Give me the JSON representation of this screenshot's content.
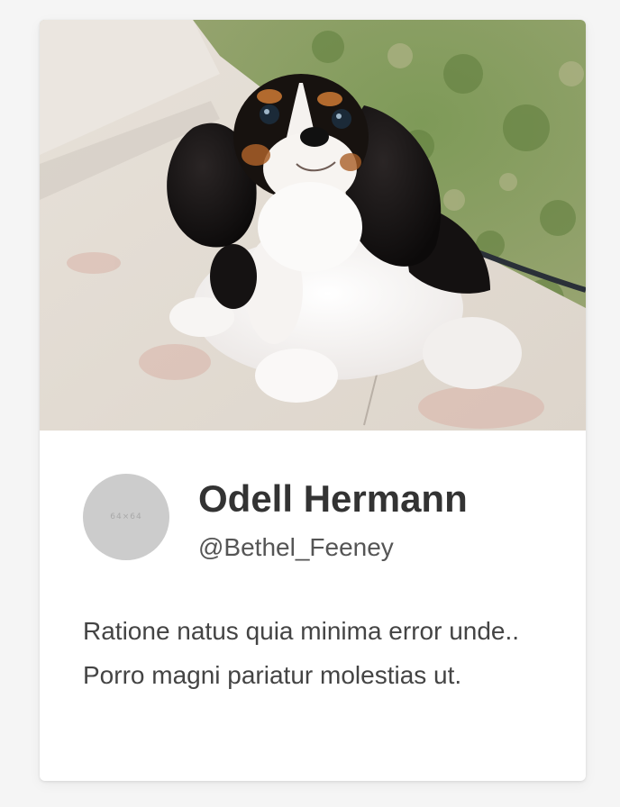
{
  "card": {
    "photo_alt": "Black, white and tan Cavalier King Charles Spaniel on a leash",
    "avatar_placeholder": "64×64",
    "name": "Odell Hermann",
    "handle": "@Bethel_Feeney",
    "bio": "Ratione natus quia minima error unde.. Porro magni pariatur molestias ut."
  },
  "colors": {
    "page_background": "#f5f5f5",
    "card_background": "#ffffff",
    "avatar_background": "#cccccc",
    "name_text": "#333333",
    "handle_text": "#555555",
    "bio_text": "#444444"
  },
  "icons": {
    "photo": "dog-photo"
  }
}
